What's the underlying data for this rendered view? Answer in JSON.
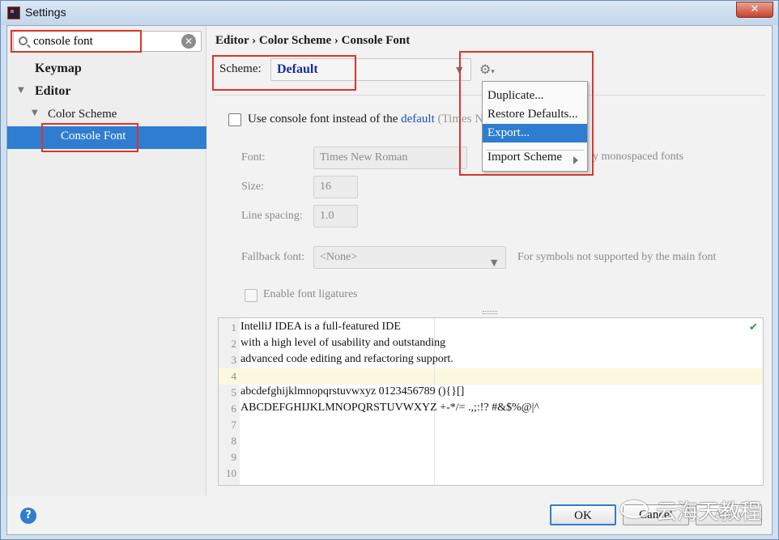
{
  "window": {
    "title": "Settings",
    "close_glyph": "✕"
  },
  "search": {
    "value": "console font",
    "clear_glyph": "✕"
  },
  "tree": {
    "keymap": "Keymap",
    "editor": "Editor",
    "color_scheme": "Color Scheme",
    "console_font": "Console Font"
  },
  "breadcrumb": "Editor › Color Scheme › Console Font",
  "scheme": {
    "label": "Scheme:",
    "value": "Default"
  },
  "gear_menu": {
    "items": [
      "Duplicate...",
      "Restore Defaults...",
      "Export...",
      "Import Scheme"
    ],
    "active_index": 2
  },
  "use_console_font": {
    "prefix": "Use console font instead of the",
    "link": "default",
    "suffix": "(Times N"
  },
  "font": {
    "label": "Font:",
    "value": "Times New Roman",
    "side_text": "y monospaced fonts"
  },
  "size": {
    "label": "Size:",
    "value": "16"
  },
  "line_spacing": {
    "label": "Line spacing:",
    "value": "1.0"
  },
  "fallback": {
    "label": "Fallback font:",
    "value": "<None>",
    "hint": "For symbols not supported by the main font"
  },
  "ligatures": {
    "label": "Enable font ligatures"
  },
  "preview": {
    "lines": [
      {
        "n": "1",
        "text": "IntelliJ IDEA is a full-featured IDE"
      },
      {
        "n": "2",
        "text": "with a high level of usability and outstanding"
      },
      {
        "n": "3",
        "text": "advanced code editing and refactoring support."
      },
      {
        "n": "4",
        "text": ""
      },
      {
        "n": "5",
        "text": "abcdefghijklmnopqrstuvwxyz 0123456789 (){}[]"
      },
      {
        "n": "6",
        "text": "ABCDEFGHIJKLMNOPQRSTUVWXYZ +-*/= .,;:!? #&$%@|^"
      },
      {
        "n": "7",
        "text": ""
      },
      {
        "n": "8",
        "text": ""
      },
      {
        "n": "9",
        "text": ""
      },
      {
        "n": "10",
        "text": ""
      }
    ]
  },
  "buttons": {
    "ok": "OK",
    "cancel": "Cancel",
    "apply": "Apply"
  },
  "help_glyph": "?",
  "watermark": "云海天教程",
  "colors": {
    "accent": "#2f7dd0",
    "highlight_box": "#e0322e",
    "scheme_text": "#1b2aa8"
  }
}
